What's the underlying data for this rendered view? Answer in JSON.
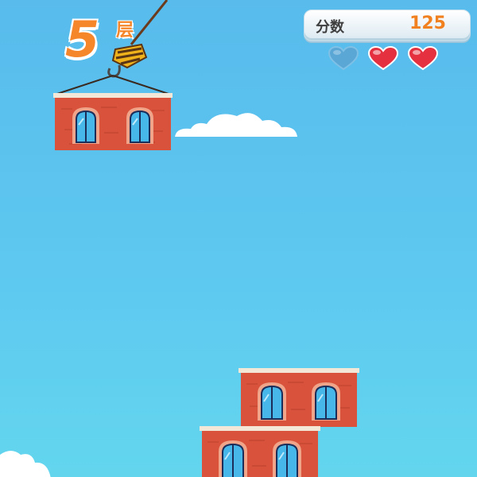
{
  "hud": {
    "floor_number": "5",
    "floor_unit": "层",
    "score_label": "分数",
    "score_value": "125"
  },
  "lives": {
    "total": 3,
    "remaining": 2,
    "colors": {
      "full": "#e5313f",
      "empty": "#5aa7d6"
    }
  },
  "palette": {
    "brick": "#d9523b",
    "brick_dark": "#b8402c",
    "window_glass": "#47b6e8",
    "sky_top": "#58bbec",
    "sky_bottom": "#63d6ee"
  }
}
